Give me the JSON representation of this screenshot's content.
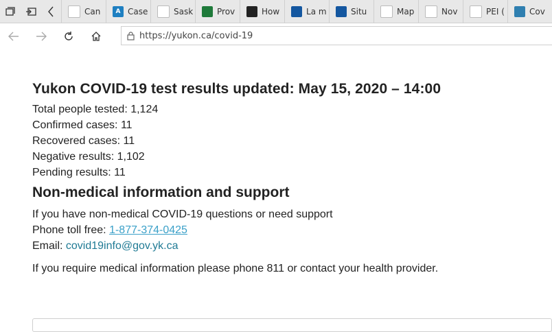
{
  "tabs": [
    {
      "label": "Can",
      "fav_color": "#ffffff",
      "fav_glyph": "",
      "icon": "canada-flag-icon"
    },
    {
      "label": "Case",
      "fav_color": "#1e7fc1",
      "fav_glyph": "A",
      "icon": "alberta-icon"
    },
    {
      "label": "Sask",
      "fav_color": "#ffffff",
      "fav_glyph": "",
      "icon": "saskatchewan-icon"
    },
    {
      "label": "Prov",
      "fav_color": "#1f7a3a",
      "fav_glyph": "",
      "icon": "manitoba-icon"
    },
    {
      "label": "How",
      "fav_color": "#222222",
      "fav_glyph": "",
      "icon": "ontario-icon"
    },
    {
      "label": "La m",
      "fav_color": "#1457a0",
      "fav_glyph": "",
      "icon": "quebec-fleur-icon"
    },
    {
      "label": "Situ",
      "fav_color": "#1457a0",
      "fav_glyph": "",
      "icon": "quebec-fleur-icon"
    },
    {
      "label": "Map",
      "fav_color": "#ffffff",
      "fav_glyph": "",
      "icon": "nova-scotia-icon"
    },
    {
      "label": "Nov",
      "fav_color": "#ffffff",
      "fav_glyph": "",
      "icon": "news-icon"
    },
    {
      "label": "PEI (",
      "fav_color": "#ffffff",
      "fav_glyph": "",
      "icon": "pei-icon"
    },
    {
      "label": "Cov",
      "fav_color": "#2f7fb0",
      "fav_glyph": "",
      "icon": "globe-icon"
    }
  ],
  "address": {
    "url": "https://yukon.ca/covid-19"
  },
  "main": {
    "title": "Yukon COVID-19 test results updated: May 15, 2020 – 14:00",
    "stats": [
      "Total people tested: 1,124",
      "Confirmed cases: 11",
      "Recovered cases: 11",
      "Negative results: 1,102",
      "Pending results: 11"
    ],
    "support_heading": "Non-medical information and support",
    "support_intro": "If you have non-medical COVID-19 questions or need support",
    "phone_label": "Phone toll free: ",
    "phone_number": "1-877-374-0425",
    "email_label": "Email: ",
    "email": "covid19info@gov.yk.ca",
    "medical_note": "If you require medical information please phone 811 or contact your health provider."
  }
}
